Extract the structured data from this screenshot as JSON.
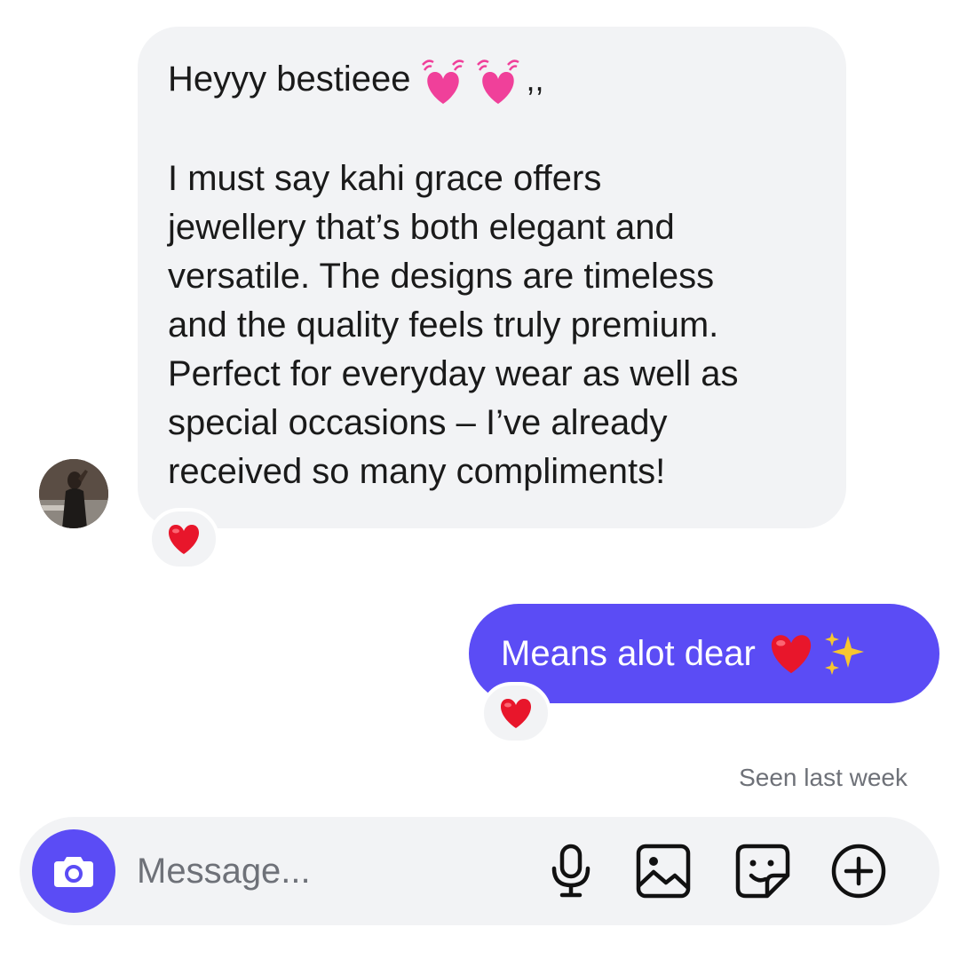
{
  "conversation": {
    "incoming": {
      "greeting": "Heyyy bestieee",
      "greeting_suffix": ",,",
      "greeting_emoji": "beating-heart-icon",
      "lines": [
        "I must say kahi grace offers",
        "jewellery that’s both elegant and",
        "versatile. The designs are timeless",
        "and the quality feels truly premium.",
        "Perfect for everyday wear as well as",
        "special occasions – I’ve already",
        "received so many compliments!"
      ],
      "reaction": "red-heart-icon"
    },
    "outgoing": {
      "text": "Means alot dear",
      "emojis": [
        "red-heart-icon",
        "sparkles-icon"
      ],
      "reaction": "red-heart-icon"
    },
    "status": "Seen last week"
  },
  "composer": {
    "placeholder": "Message...",
    "camera_icon": "camera-icon",
    "tools": [
      "microphone-icon",
      "image-icon",
      "sticker-icon",
      "plus-circle-icon"
    ]
  },
  "colors": {
    "accent": "#5b4cf5",
    "bubble_in": "#f2f3f5",
    "muted_text": "#6e7178",
    "heart": "#e8162b",
    "pink_heart": "#f0409a"
  }
}
